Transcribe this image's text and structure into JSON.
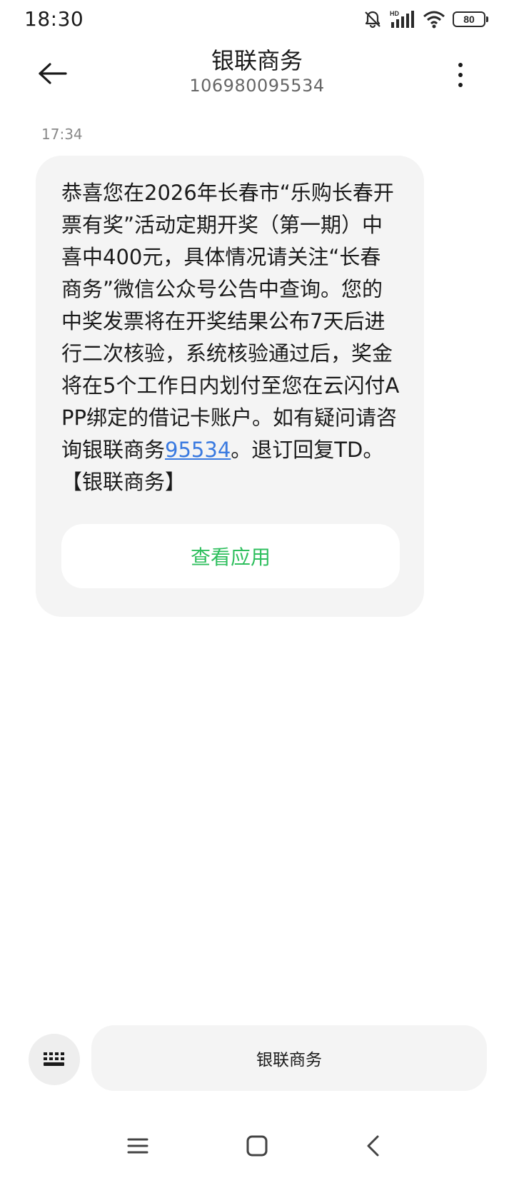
{
  "status_bar": {
    "time": "18:30",
    "battery_level": "80",
    "icons": [
      "bell-off-icon",
      "hd-signal-icon",
      "wifi-icon",
      "battery-icon"
    ]
  },
  "header": {
    "title": "银联商务",
    "number": "106980095534",
    "back_icon": "arrow-left-icon",
    "more_icon": "more-vertical-icon"
  },
  "message": {
    "time": "17:34",
    "text_before_link": "恭喜您在2026年长春市“乐购长春开票有奖”活动定期开奖（第一期）中喜中400元，具体情况请关注“长春商务”微信公众号公告中查询。您的中奖发票将在开奖结果公布7天后进行二次核验，系统核验通过后，奖金将在5个工作日内划付至您在云闪付APP绑定的借记卡账户。如有疑问请咨询银联商务",
    "link_text": "95534",
    "text_after_link": "。退订回复TD。【银联商务】",
    "app_button_label": "查看应用",
    "bubble_color": "#f4f4f4",
    "link_color": "#3a7ae0",
    "button_text_color": "#2fbf5e"
  },
  "input_bar": {
    "keyboard_icon": "keyboard-icon",
    "reply_label": "银联商务"
  },
  "nav_bar": {
    "icons": [
      "menu-icon",
      "home-square-icon",
      "back-chevron-icon"
    ]
  }
}
